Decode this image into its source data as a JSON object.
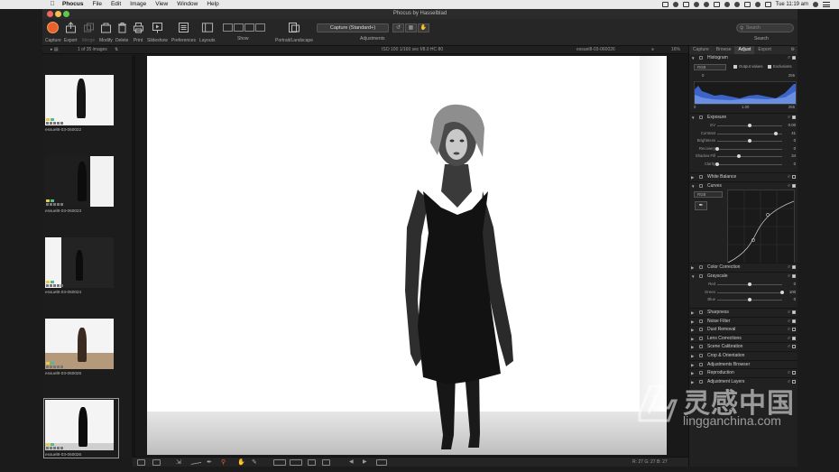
{
  "menubar": {
    "app_name": "Phocus",
    "menus": [
      "File",
      "Edit",
      "Image",
      "View",
      "Window",
      "Help"
    ],
    "clock": "Tue 11:19 am"
  },
  "window": {
    "title": "Phocus by Hasselblad"
  },
  "toolbar": {
    "capture": "Capture",
    "export": "Export",
    "merge": "Merge",
    "modify": "Modify",
    "delete": "Delete",
    "print": "Print",
    "slideshow": "Slideshow",
    "preferences": "Preferences",
    "layouts": "Layouts",
    "show": "Show",
    "portrait_landscape": "Portrait/Landscape",
    "adjustments": "Adjustments",
    "adjustment_preset": "Capture (Standard+)",
    "search_placeholder": "Search",
    "search_label": "Search"
  },
  "browser": {
    "image_count": "1 of 35 images",
    "exposure_info": "ISO 100  1/160 sec  f/8.0  HC 80",
    "filename": "essuel8-03-060026",
    "zoom": "16%"
  },
  "thumbnails": [
    {
      "name": "essuel8-03-060022"
    },
    {
      "name": "essuel8-03-060023"
    },
    {
      "name": "essuel8-03-060024"
    },
    {
      "name": "essuel8-03-060025"
    },
    {
      "name": "essuel8-03-060026"
    }
  ],
  "bottombar": {
    "readout": "R: 27  G: 27  B: 27"
  },
  "right_panel": {
    "tabs": [
      "Capture",
      "Browse",
      "Adjust",
      "Export"
    ],
    "active_tab": "Adjust",
    "histogram": {
      "title": "Histogram",
      "mode": "RGB",
      "output_values": "Output values",
      "exclusions": "Exclusions",
      "shadow_value": "0",
      "gamma_value": "1.00",
      "highlight_value": "255",
      "left_value": "0",
      "right_value": "255"
    },
    "exposure": {
      "title": "Exposure",
      "sliders": [
        {
          "label": "EV",
          "value": "0.00",
          "pos": 0.5
        },
        {
          "label": "Contrast",
          "value": "41",
          "pos": 0.9
        },
        {
          "label": "Brightness",
          "value": "0",
          "pos": 0.5
        },
        {
          "label": "Recovery",
          "value": "0",
          "pos": 0.0
        },
        {
          "label": "Shadow Fill",
          "value": "34",
          "pos": 0.34
        },
        {
          "label": "Clarity",
          "value": "0",
          "pos": 0.0
        }
      ]
    },
    "white_balance": {
      "title": "White Balance"
    },
    "curves": {
      "title": "Curves",
      "mode": "RGB"
    },
    "color_correction": {
      "title": "Color Correction"
    },
    "grayscale": {
      "title": "Grayscale",
      "sliders": [
        {
          "label": "Red",
          "value": "0",
          "pos": 0.5
        },
        {
          "label": "Green",
          "value": "100",
          "pos": 1.0
        },
        {
          "label": "Blue",
          "value": "0",
          "pos": 0.5
        }
      ]
    },
    "tools": [
      {
        "title": "Sharpness",
        "checked": true
      },
      {
        "title": "Noise Filter",
        "checked": true
      },
      {
        "title": "Dust Removal",
        "checked": false
      },
      {
        "title": "Lens Corrections",
        "checked": true
      },
      {
        "title": "Scene Calibration",
        "checked": false
      },
      {
        "title": "Crop & Orientation",
        "checked": null
      },
      {
        "title": "Adjustments Browser",
        "checked": null
      },
      {
        "title": "Reproduction",
        "checked": false
      },
      {
        "title": "Adjustment Layers",
        "checked": false
      }
    ]
  },
  "watermark": {
    "chinese": "灵感中国",
    "url": "lingganchina.com"
  },
  "colors": {
    "accent_capture": "#e8632b",
    "histogram_fill": "#3b63c8",
    "traffic_red": "#ed6a5e",
    "traffic_yellow": "#f5bf4f",
    "traffic_green": "#61c554"
  }
}
